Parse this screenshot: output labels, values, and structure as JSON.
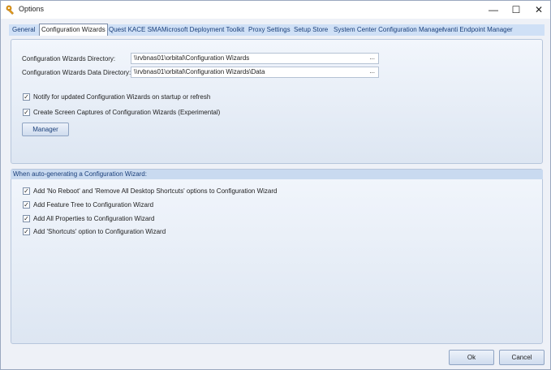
{
  "window": {
    "title": "Options",
    "app_icon": "wrench-key-icon",
    "controls": {
      "minimize": "—",
      "maximize": "☐",
      "close": "✕"
    }
  },
  "tabs": [
    {
      "label": "General",
      "active": false
    },
    {
      "label": "Configuration Wizards",
      "active": true
    },
    {
      "label": "Quest KACE SMA",
      "active": false
    },
    {
      "label": "Microsoft Deployment Toolkit",
      "active": false
    },
    {
      "label": "Proxy Settings",
      "active": false
    },
    {
      "label": "Setup Store",
      "active": false
    },
    {
      "label": "System Center Configuration Manager",
      "active": false
    },
    {
      "label": "Ivanti Endpoint Manager",
      "active": false
    }
  ],
  "directories": {
    "wizards_dir_label": "Configuration Wizards Directory:",
    "wizards_dir_value": "\\\\rvbnas01\\orbital\\Configuration Wizards",
    "data_dir_label": "Configuration Wizards Data Directory:",
    "data_dir_value": "\\\\rvbnas01\\orbital\\Configuration Wizards\\Data",
    "browse_label": "..."
  },
  "options": [
    {
      "label": "Notify for updated Configuration Wizards on startup or refresh",
      "checked": true
    },
    {
      "label": "Create Screen Captures of Configuration Wizards (Experimental)",
      "checked": true
    }
  ],
  "manager_button": "Manager",
  "auto_generate": {
    "header": "When auto-generating a Configuration Wizard:",
    "items": [
      {
        "label": "Add 'No Reboot' and 'Remove All Desktop Shortcuts' options to Configuration Wizard",
        "checked": true
      },
      {
        "label": "Add Feature Tree to Configuration Wizard",
        "checked": true
      },
      {
        "label": "Add All Properties to Configuration Wizard",
        "checked": true
      },
      {
        "label": "Add 'Shortcuts' option to Configuration Wizard",
        "checked": true
      }
    ]
  },
  "check_mark": "✓",
  "footer": {
    "ok": "Ok",
    "cancel": "Cancel"
  },
  "colors": {
    "accent": "#1a3f7a",
    "tab_strip": "#cfe0f6",
    "panel": "#e6edf7"
  }
}
